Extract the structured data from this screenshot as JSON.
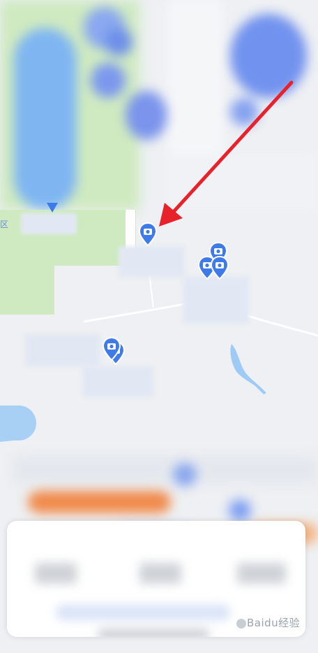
{
  "map": {
    "side_tag": "区"
  },
  "markers": [
    {
      "name": "marker-target",
      "icon": "camera-pin-icon"
    },
    {
      "name": "marker-cluster-1",
      "icon": "camera-pin-icon"
    },
    {
      "name": "marker-cluster-2",
      "icon": "camera-pin-icon"
    },
    {
      "name": "marker-cluster-3",
      "icon": "camera-pin-icon"
    },
    {
      "name": "marker-west",
      "icon": "camera-pin-icon"
    },
    {
      "name": "marker-west-2",
      "icon": "camera-pin-icon"
    }
  ],
  "annotation": {
    "arrow_color": "#e8222b"
  },
  "colors": {
    "pin_blue": "#3f7be8",
    "accent_orange": "#f08a4b",
    "water": "#9ecbf5",
    "park": "#cfeac0"
  },
  "watermark": {
    "text": "Baidu经验"
  }
}
